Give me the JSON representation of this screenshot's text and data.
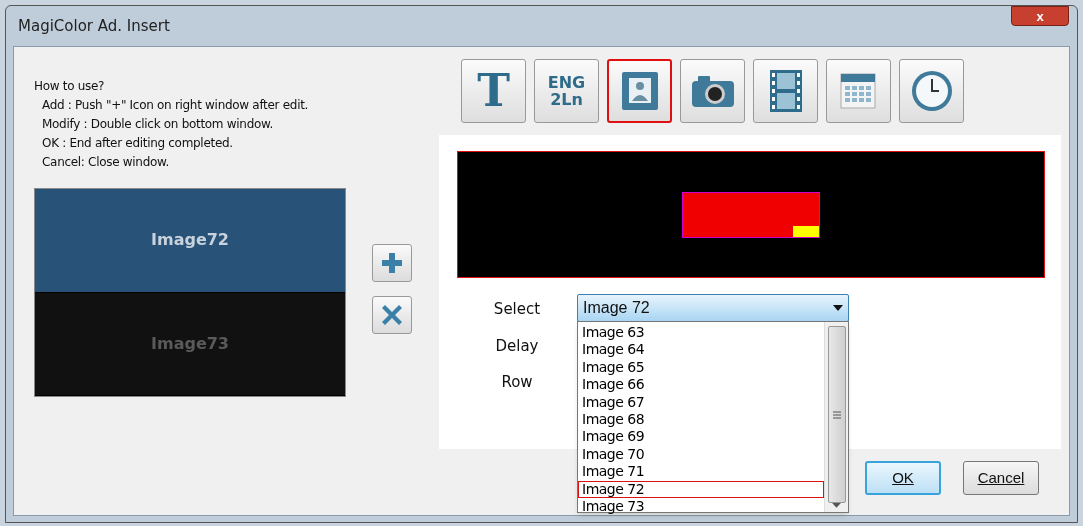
{
  "window": {
    "title": "MagiColor Ad. Insert",
    "close": "x"
  },
  "help": {
    "heading": "How to use?",
    "lines": [
      "Add : Push \"+\" Icon on right window after edit.",
      "Modify : Double click on bottom window.",
      "OK : End after editing completed.",
      "Cancel: Close window."
    ]
  },
  "slides": [
    {
      "label": "Image72",
      "selected": true
    },
    {
      "label": "Image73",
      "selected": false
    }
  ],
  "side_buttons": [
    {
      "kind": "add"
    },
    {
      "kind": "delete"
    }
  ],
  "toolbar": [
    {
      "kind": "text",
      "glyph": "T",
      "selected": false
    },
    {
      "kind": "eng",
      "lines": [
        "ENG",
        "2Ln"
      ],
      "selected": false
    },
    {
      "kind": "picture",
      "selected": true
    },
    {
      "kind": "camera",
      "selected": false
    },
    {
      "kind": "film",
      "selected": false
    },
    {
      "kind": "calendar",
      "selected": false
    },
    {
      "kind": "clock",
      "selected": false
    }
  ],
  "form": {
    "select_label": "Select",
    "delay_label": "Delay",
    "row_label": "Row",
    "select_value": "Image 72",
    "options": [
      {
        "label": "Image 63",
        "selected": false
      },
      {
        "label": "Image 64",
        "selected": false
      },
      {
        "label": "Image 65",
        "selected": false
      },
      {
        "label": "Image 66",
        "selected": false
      },
      {
        "label": "Image 67",
        "selected": false
      },
      {
        "label": "Image 68",
        "selected": false
      },
      {
        "label": "Image 69",
        "selected": false
      },
      {
        "label": "Image 70",
        "selected": false
      },
      {
        "label": "Image 71",
        "selected": false
      },
      {
        "label": "Image 72",
        "selected": true
      },
      {
        "label": "Image 73",
        "selected": false
      }
    ]
  },
  "buttons": [
    {
      "label": "OK",
      "kind": "default"
    },
    {
      "label": "Cancel",
      "kind": "normal"
    }
  ]
}
